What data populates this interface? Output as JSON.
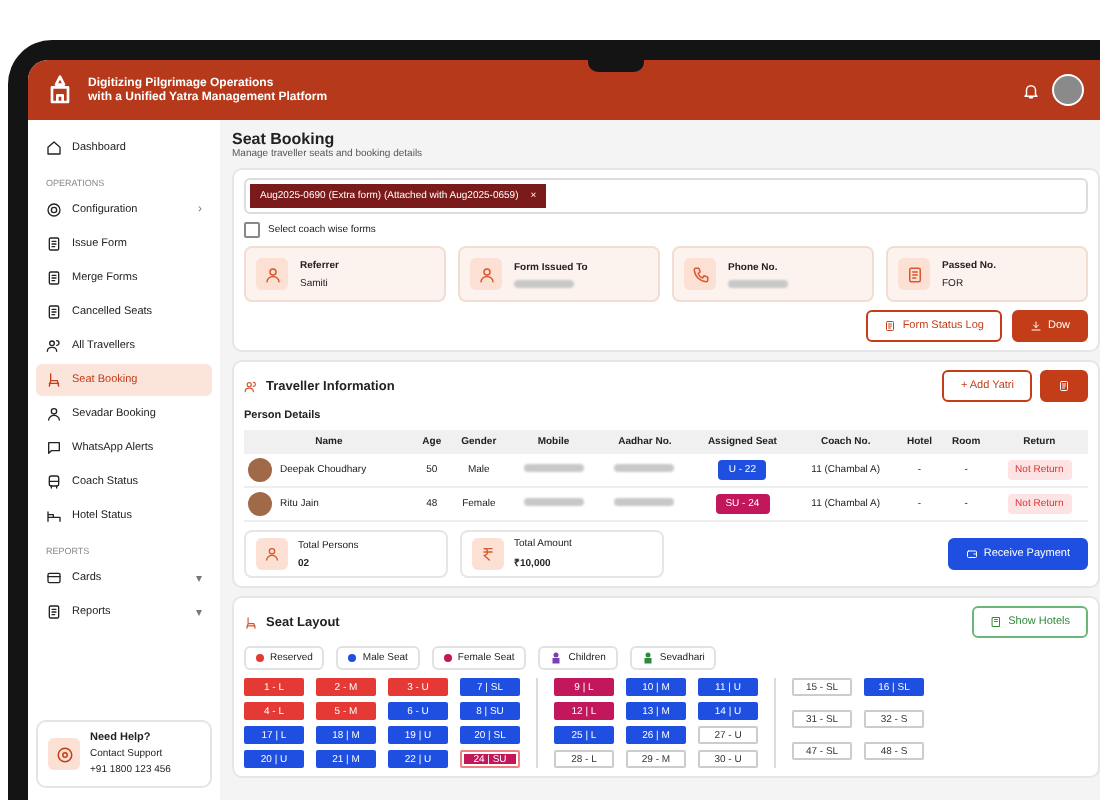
{
  "header": {
    "title": "Digitizing Pilgrimage Operations",
    "subtitle": "with a Unified Yatra Management Platform"
  },
  "sidebar": {
    "top": [
      {
        "label": "Dashboard",
        "selected": false
      }
    ],
    "sections": [
      {
        "heading": "OPERATIONS",
        "items": [
          {
            "label": "Configuration",
            "selected": false,
            "arrow": "›"
          },
          {
            "label": "Issue Form",
            "selected": false
          },
          {
            "label": "Merge Forms",
            "selected": false
          },
          {
            "label": "Cancelled Seats",
            "selected": false
          },
          {
            "label": "All Travellers",
            "selected": false
          },
          {
            "label": "Seat Booking",
            "selected": true
          },
          {
            "label": "Sevadar Booking",
            "selected": false
          },
          {
            "label": "WhatsApp Alerts",
            "selected": false
          },
          {
            "label": "Coach Status",
            "selected": false
          },
          {
            "label": "Hotel Status",
            "selected": false
          }
        ]
      },
      {
        "heading": "REPORTS",
        "items": [
          {
            "label": "Cards",
            "selected": false,
            "arrow": "▾"
          },
          {
            "label": "Reports",
            "selected": false,
            "arrow": "▾"
          }
        ]
      }
    ],
    "help": {
      "title": "Need Help?",
      "text": "Contact Support",
      "phone": "+91 1800 123 456"
    }
  },
  "page": {
    "title": "Seat Booking",
    "subtitle": "Manage traveller seats and booking details"
  },
  "form": {
    "chip": "Aug2025-0690 (Extra form) (Attached with Aug2025-0659)",
    "chip_close": "×",
    "coach_wise": {
      "label": "Select coach wise forms",
      "checked": false
    },
    "info": [
      {
        "label": "Referrer",
        "value": "Samiti"
      },
      {
        "label": "Form Issued To"
      },
      {
        "label": "Phone No."
      },
      {
        "label": "Passed No.",
        "value": "FOR"
      }
    ],
    "buttons": [
      {
        "label": "Form Status Log",
        "kind": "outline"
      },
      {
        "label": "Dow",
        "kind": "filled"
      }
    ]
  },
  "travellers": {
    "title": "Traveller Information",
    "add": "+ Add Yatri",
    "subtitle": "Person Details",
    "columns": [
      "Name",
      "Age",
      "Gender",
      "Mobile",
      "Aadhar No.",
      "Assigned Seat",
      "Coach No.",
      "Hotel",
      "Room",
      "Return"
    ],
    "rows": [
      {
        "name": "Deepak Choudhary",
        "age": "50",
        "gender": "Male",
        "seat": {
          "label": "U - 22",
          "color": "#1e4fe0"
        },
        "coach": "11 (Chambal A)",
        "hotel": "-",
        "room": "-",
        "return": "Not Return"
      },
      {
        "name": "Ritu Jain",
        "age": "48",
        "gender": "Female",
        "seat": {
          "label": "SU - 24",
          "color": "#c2185b"
        },
        "coach": "11 (Chambal A)",
        "hotel": "-",
        "room": "-",
        "return": "Not Return"
      }
    ],
    "totals": [
      {
        "label": "Total Persons",
        "value": "02"
      },
      {
        "label": "Total Amount",
        "value": "₹10,000"
      }
    ],
    "payment": "Receive Payment"
  },
  "seat_layout": {
    "title": "Seat Layout",
    "show_hotels": "Show Hotels",
    "legend": [
      {
        "label": "Reserved",
        "kind": "dot",
        "color": "#e53935"
      },
      {
        "label": "Male Seat",
        "kind": "dot",
        "color": "#1e4fe0"
      },
      {
        "label": "Female Seat",
        "kind": "dot",
        "color": "#c2185b"
      },
      {
        "label": "Children",
        "kind": "icon",
        "color": "#7b3fb5"
      },
      {
        "label": "Sevadhari",
        "kind": "icon",
        "color": "#2e8b3a"
      }
    ],
    "groups": [
      {
        "seats": [
          {
            "label": "1 - L",
            "kind": "reserved",
            "selected": false
          },
          {
            "label": "2 - M",
            "kind": "reserved",
            "selected": false
          },
          {
            "label": "3 - U",
            "kind": "reserved",
            "selected": false
          },
          {
            "label": "7 | SL",
            "kind": "male",
            "selected": false
          },
          {
            "label": "4 - L",
            "kind": "reserved",
            "selected": false
          },
          {
            "label": "5 - M",
            "kind": "reserved",
            "selected": false
          },
          {
            "label": "6 - U",
            "kind": "male",
            "selected": false
          },
          {
            "label": "8 | SU",
            "kind": "male",
            "selected": false
          },
          {
            "label": "17 | L",
            "kind": "male",
            "selected": false
          },
          {
            "label": "18 | M",
            "kind": "male",
            "selected": false
          },
          {
            "label": "19 | U",
            "kind": "male",
            "selected": false
          },
          {
            "label": "20 | SL",
            "kind": "male",
            "selected": false
          },
          {
            "label": "20 | U",
            "kind": "male",
            "selected": false
          },
          {
            "label": "21 | M",
            "kind": "male",
            "selected": false
          },
          {
            "label": "22 | U",
            "kind": "male",
            "selected": false
          },
          {
            "label": "24 | SU",
            "kind": "female",
            "selected": true
          }
        ]
      },
      {
        "seats": [
          {
            "label": "9 | L",
            "kind": "female",
            "selected": false
          },
          {
            "label": "10 | M",
            "kind": "male",
            "selected": false
          },
          {
            "label": "11 | U",
            "kind": "male",
            "selected": false
          },
          {
            "label": "12 | L",
            "kind": "female",
            "selected": false
          },
          {
            "label": "13 | M",
            "kind": "male",
            "selected": false
          },
          {
            "label": "14 | U",
            "kind": "male",
            "selected": false
          },
          {
            "label": "25 | L",
            "kind": "male",
            "selected": false
          },
          {
            "label": "26 | M",
            "kind": "male",
            "selected": false
          },
          {
            "label": "27 - U",
            "kind": "empty",
            "selected": false
          },
          {
            "label": "28 - L",
            "kind": "empty",
            "selected": false
          },
          {
            "label": "29 - M",
            "kind": "empty",
            "selected": false
          },
          {
            "label": "30 - U",
            "kind": "empty",
            "selected": false
          }
        ]
      },
      {
        "seats": [
          {
            "label": "15 - SL",
            "kind": "empty",
            "selected": false
          },
          {
            "label": "16 | SL",
            "kind": "male",
            "selected": false
          },
          {
            "label": "31 - SL",
            "kind": "empty",
            "selected": false
          },
          {
            "label": "32 - S",
            "kind": "empty",
            "selected": false
          },
          {
            "label": "47 - SL",
            "kind": "empty",
            "selected": false
          },
          {
            "label": "48 - S",
            "kind": "empty",
            "selected": false
          }
        ]
      }
    ]
  }
}
